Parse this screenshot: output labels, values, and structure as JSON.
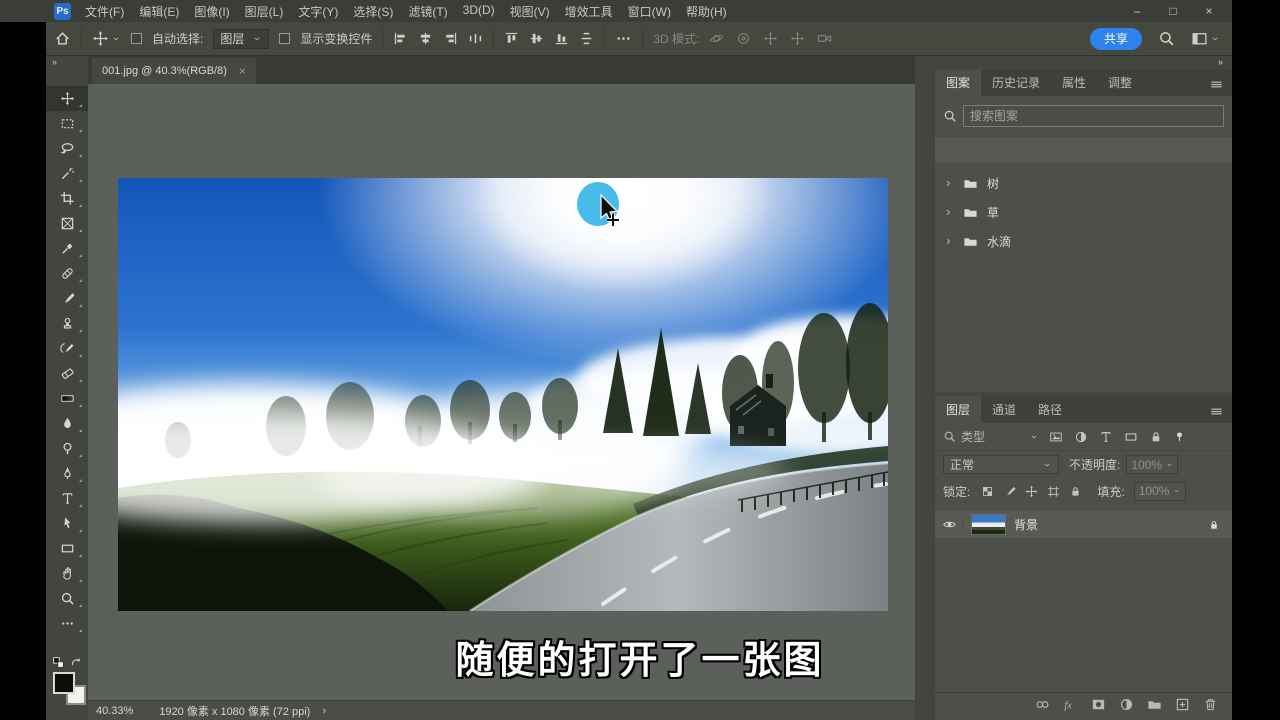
{
  "titlebar": {
    "logo": "Ps",
    "menus": [
      "文件(F)",
      "编辑(E)",
      "图像(I)",
      "图层(L)",
      "文字(Y)",
      "选择(S)",
      "滤镜(T)",
      "3D(D)",
      "视图(V)",
      "增效工具",
      "窗口(W)",
      "帮助(H)"
    ],
    "window": [
      "–",
      "□",
      "×"
    ]
  },
  "optionsbar": {
    "auto_select": "自动选择:",
    "target": "图层",
    "show_transform": "显示变换控件",
    "mode3d": "3D 模式:",
    "share": "共享",
    "align_icons": [
      "al",
      "ach",
      "ar",
      "adh"
    ],
    "align_icons2": [
      "at",
      "amv",
      "ab",
      "adv"
    ],
    "icons3d": [
      "orbit",
      "ring",
      "move",
      "move",
      "cam"
    ]
  },
  "toolbar": {
    "collapse": "»",
    "tools": [
      {
        "name": "move",
        "icon": "move",
        "cls": "active"
      },
      {
        "name": "marquee",
        "icon": "marquee"
      },
      {
        "name": "lasso",
        "icon": "lasso"
      },
      {
        "name": "magic-wand",
        "icon": "wand"
      },
      {
        "name": "crop",
        "icon": "crop"
      },
      {
        "name": "frame",
        "icon": "frame"
      },
      {
        "name": "eyedropper",
        "icon": "eyedrop"
      },
      {
        "name": "healing-brush",
        "icon": "heal"
      },
      {
        "name": "brush",
        "icon": "brush"
      },
      {
        "name": "clone-stamp",
        "icon": "stamp"
      },
      {
        "name": "history-brush",
        "icon": "history"
      },
      {
        "name": "eraser",
        "icon": "eraser"
      },
      {
        "name": "gradient",
        "icon": "gradient"
      },
      {
        "name": "blur",
        "icon": "blur"
      },
      {
        "name": "dodge",
        "icon": "dodge"
      },
      {
        "name": "pen",
        "icon": "pen"
      },
      {
        "name": "type",
        "icon": "type"
      },
      {
        "name": "path-select",
        "icon": "select"
      },
      {
        "name": "shape",
        "icon": "shape"
      },
      {
        "name": "hand",
        "icon": "hand"
      },
      {
        "name": "zoom",
        "icon": "zoom"
      },
      {
        "name": "edit-toolbar",
        "icon": "more"
      }
    ]
  },
  "document": {
    "tab": "001.jpg @ 40.3%(RGB/8)",
    "close": "×"
  },
  "statusbar": {
    "zoom": "40.33%",
    "info": "1920 像素 x 1080 像素 (72 ppi)",
    "chevron": "›"
  },
  "panels": {
    "collapse": "»",
    "top_tabs": [
      "图案",
      "历史记录",
      "属性",
      "调整"
    ],
    "patterns": {
      "search_placeholder": "搜索图案",
      "folders": [
        "树",
        "草",
        "水滴"
      ],
      "footer_icons": [
        "folder",
        "plusbox",
        "trash"
      ]
    },
    "layers": {
      "tabs": [
        "图层",
        "通道",
        "路径"
      ],
      "filter_label": "类型",
      "filter_icons": [
        "pix",
        "adjust",
        "type",
        "shape",
        "lock"
      ],
      "blend": "正常",
      "opacity_label": "不透明度:",
      "opacity": "100%",
      "lock_label": "锁定:",
      "lock_icons": [
        "grid",
        "brush",
        "move",
        "artboard",
        "lock"
      ],
      "fill_label": "填充:",
      "fill": "100%",
      "layer_name": "背景",
      "footer_icons": [
        "link",
        "fx",
        "mask",
        "adjust",
        "folder",
        "plusbox",
        "trash"
      ]
    }
  },
  "subtitle": "随便的打开了一张图",
  "colors": {
    "accent_blue": "#2e82ed",
    "panel_bg": "#4d5048",
    "titlebar_bg": "#3b3e38",
    "pasteboard": "#5c605a"
  }
}
